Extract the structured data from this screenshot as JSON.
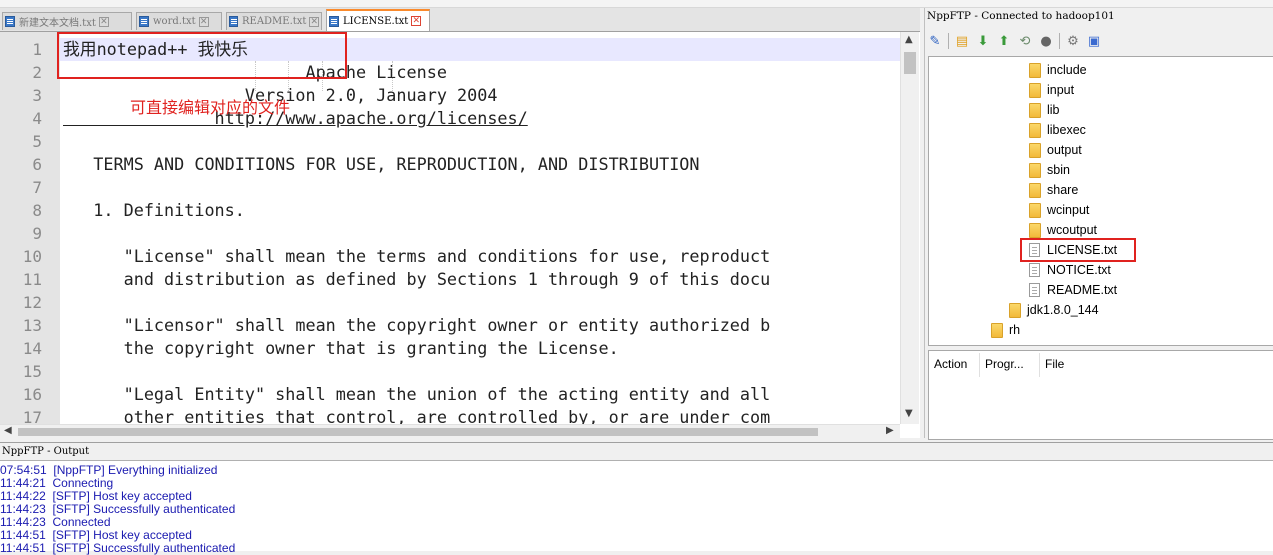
{
  "tabs": [
    {
      "label": "新建文本文档.txt",
      "active": false
    },
    {
      "label": "word.txt",
      "active": false
    },
    {
      "label": "README.txt",
      "active": false
    },
    {
      "label": "LICENSE.txt",
      "active": true
    }
  ],
  "editor": {
    "line_numbers": [
      "1",
      "2",
      "3",
      "4",
      "5",
      "6",
      "7",
      "8",
      "9",
      "10",
      "11",
      "12",
      "13",
      "14",
      "15",
      "16",
      "17"
    ],
    "lines": [
      "我用notepad++ 我快乐",
      "                        Apache License",
      "                  Version 2.0, January 2004",
      "               http://www.apache.org/licenses/",
      "",
      "   TERMS AND CONDITIONS FOR USE, REPRODUCTION, AND DISTRIBUTION",
      "",
      "   1. Definitions.",
      "",
      "      \"License\" shall mean the terms and conditions for use, reproduct",
      "      and distribution as defined by Sections 1 through 9 of this docu",
      "",
      "      \"Licensor\" shall mean the copyright owner or entity authorized b",
      "      the copyright owner that is granting the License.",
      "",
      "      \"Legal Entity\" shall mean the union of the acting entity and all",
      "      other entities that control, are controlled by, or are under com"
    ],
    "annotation": "可直接编辑对应的文件"
  },
  "ftp": {
    "title": "NppFTP - Connected to hadoop101",
    "toolbar_icons": [
      "connect-icon",
      "folder-icon",
      "download-icon",
      "upload-icon",
      "refresh-icon",
      "abort-icon",
      "settings-icon",
      "window-icon"
    ],
    "tree": [
      {
        "name": "include",
        "type": "folder",
        "indent": 1
      },
      {
        "name": "input",
        "type": "folder",
        "indent": 1
      },
      {
        "name": "lib",
        "type": "folder",
        "indent": 1
      },
      {
        "name": "libexec",
        "type": "folder",
        "indent": 1
      },
      {
        "name": "output",
        "type": "folder",
        "indent": 1
      },
      {
        "name": "sbin",
        "type": "folder",
        "indent": 1
      },
      {
        "name": "share",
        "type": "folder",
        "indent": 1
      },
      {
        "name": "wcinput",
        "type": "folder",
        "indent": 1
      },
      {
        "name": "wcoutput",
        "type": "folder",
        "indent": 1
      },
      {
        "name": "LICENSE.txt",
        "type": "file",
        "indent": 1
      },
      {
        "name": "NOTICE.txt",
        "type": "file",
        "indent": 1
      },
      {
        "name": "README.txt",
        "type": "file",
        "indent": 1
      },
      {
        "name": "jdk1.8.0_144",
        "type": "folder",
        "indent": 0
      },
      {
        "name": "rh",
        "type": "folder",
        "indent": -1
      }
    ],
    "queue_headers": [
      "Action",
      "Progr...",
      "File"
    ]
  },
  "output": {
    "title": "NppFTP - Output",
    "log": [
      "07:54:51  [NppFTP] Everything initialized",
      "11:44:21  Connecting",
      "11:44:22  [SFTP] Host key accepted",
      "11:44:23  [SFTP] Successfully authenticated",
      "11:44:23  Connected",
      "11:44:51  [SFTP] Host key accepted",
      "11:44:51  [SFTP] Successfully authenticated"
    ]
  }
}
